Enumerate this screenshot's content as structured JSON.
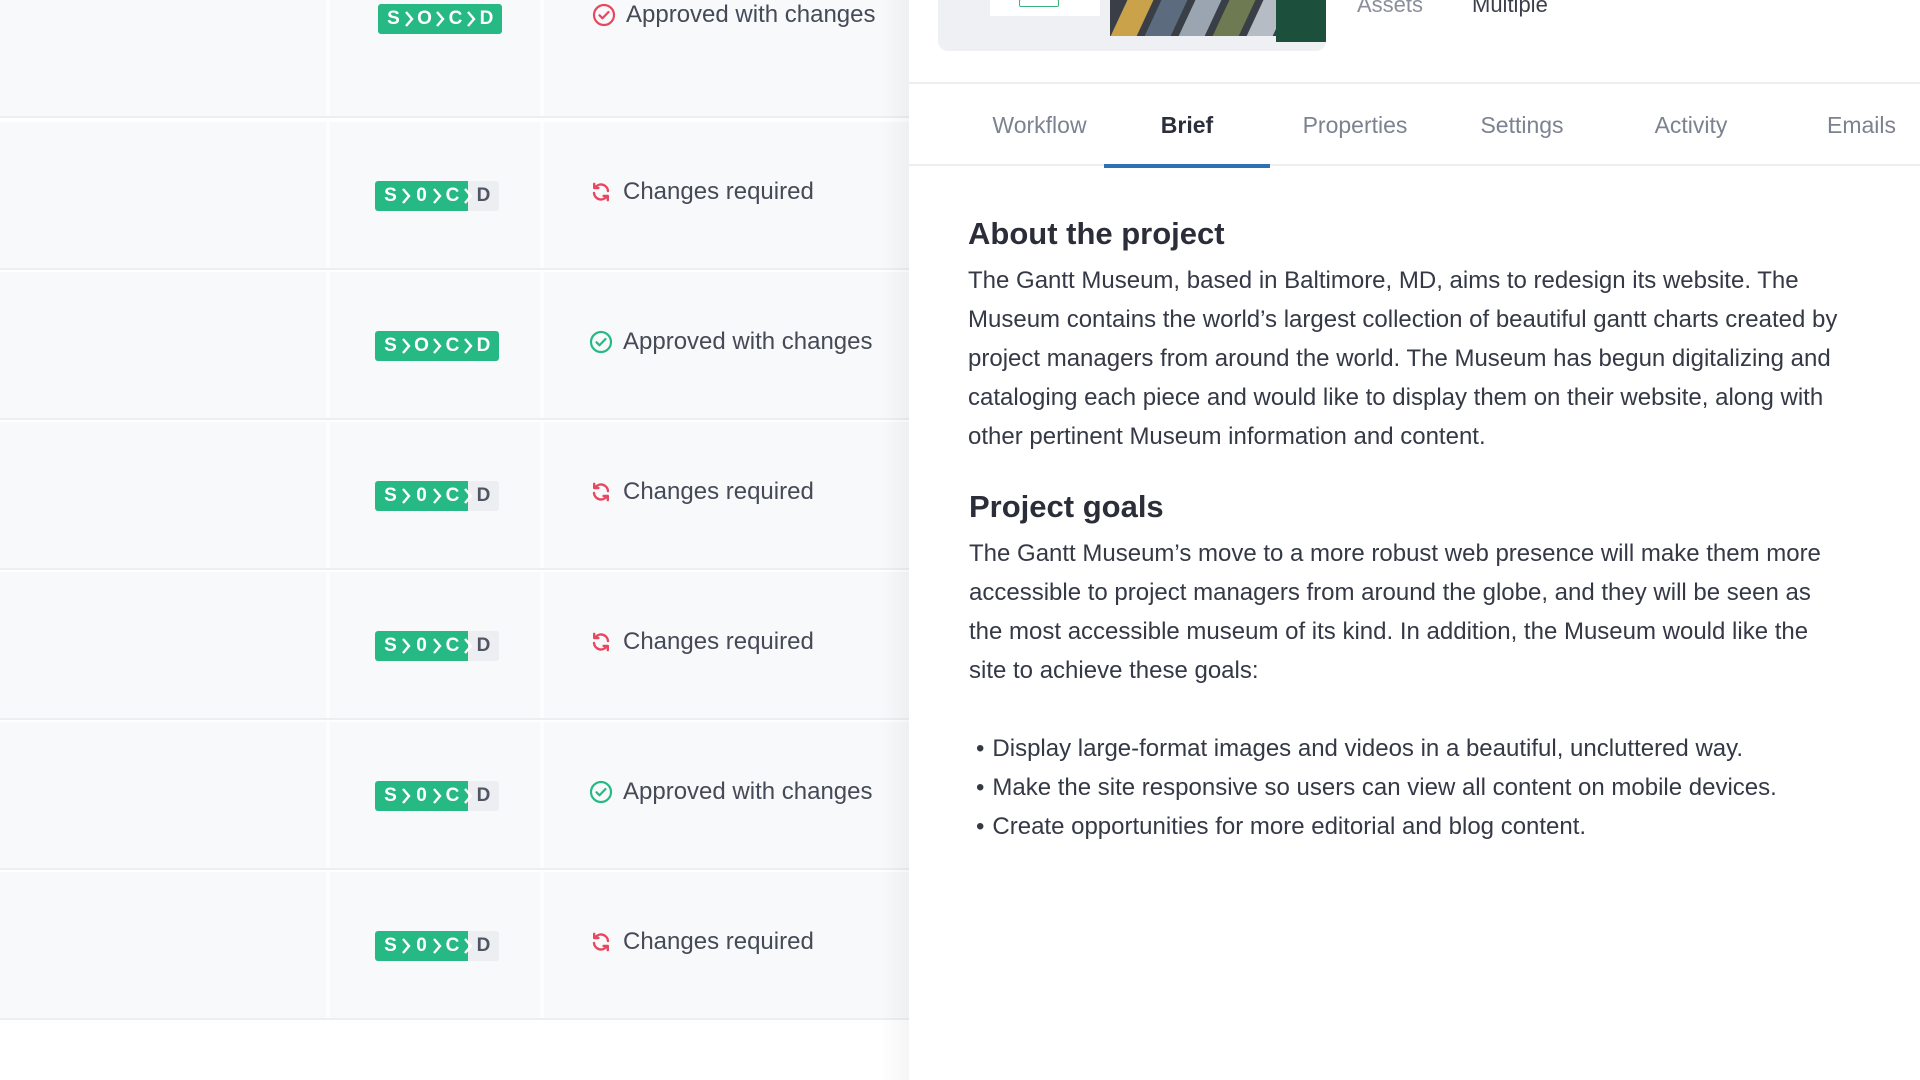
{
  "table": {
    "rows": [
      {
        "socd": [
          "S",
          "O",
          "C",
          "D"
        ],
        "socd_state": [
          true,
          true,
          true,
          true
        ],
        "status": "Approved with changes",
        "status_type": "approved-red"
      },
      {
        "socd": [
          "S",
          "0",
          "C",
          "D"
        ],
        "socd_state": [
          true,
          true,
          true,
          false
        ],
        "status": "Changes required",
        "status_type": "changes"
      },
      {
        "socd": [
          "S",
          "O",
          "C",
          "D"
        ],
        "socd_state": [
          true,
          true,
          true,
          true
        ],
        "status": "Approved with changes",
        "status_type": "approved-green"
      },
      {
        "socd": [
          "S",
          "0",
          "C",
          "D"
        ],
        "socd_state": [
          true,
          true,
          true,
          false
        ],
        "status": "Changes required",
        "status_type": "changes"
      },
      {
        "socd": [
          "S",
          "0",
          "C",
          "D"
        ],
        "socd_state": [
          true,
          true,
          true,
          false
        ],
        "status": "Changes required",
        "status_type": "changes"
      },
      {
        "socd": [
          "S",
          "0",
          "C",
          "D"
        ],
        "socd_state": [
          true,
          true,
          true,
          false
        ],
        "status": "Approved with changes",
        "status_type": "approved-green"
      },
      {
        "socd": [
          "S",
          "0",
          "C",
          "D"
        ],
        "socd_state": [
          true,
          true,
          true,
          false
        ],
        "status": "Changes required",
        "status_type": "changes"
      }
    ]
  },
  "panel": {
    "meta": {
      "label": "Assets",
      "value": "Multiple"
    },
    "tabs": [
      {
        "label": "Workflow",
        "active": false
      },
      {
        "label": "Brief",
        "active": true
      },
      {
        "label": "Properties",
        "active": false
      },
      {
        "label": "Settings",
        "active": false
      },
      {
        "label": "Activity",
        "active": false
      },
      {
        "label": "Emails",
        "active": false
      }
    ],
    "brief": {
      "about_title": "About the project",
      "about_text": "The Gantt Museum, based in Baltimore, MD, aims to redesign its website. The Museum contains the world’s largest collection of beautiful gantt charts created by project managers from around the world. The Museum has begun digitalizing and cataloging each piece and would like to display them on their website, along with other pertinent Museum information and content.",
      "goals_title": "Project goals",
      "goals_text": "The Gantt Museum’s move to a more robust web presence will make them more accessible to project managers from around the globe, and they will be seen as the most accessible museum of its kind. In addition, the Museum would like the site to achieve these goals:",
      "goals": [
        "Display large-format images and videos in a beautiful, uncluttered way.",
        "Make the site responsive so users can view all content on mobile devices.",
        "Create opportunities for more editorial and blog content."
      ]
    }
  },
  "colors": {
    "socd_on": "#27b984",
    "socd_off": "#eceef2",
    "approved_green": "#27b984",
    "approved_red": "#e8475f",
    "changes": "#e8475f",
    "tab_underline": "#2f6fb3"
  },
  "icons": {
    "approved": "check-circle-icon",
    "changes": "refresh-icon"
  }
}
